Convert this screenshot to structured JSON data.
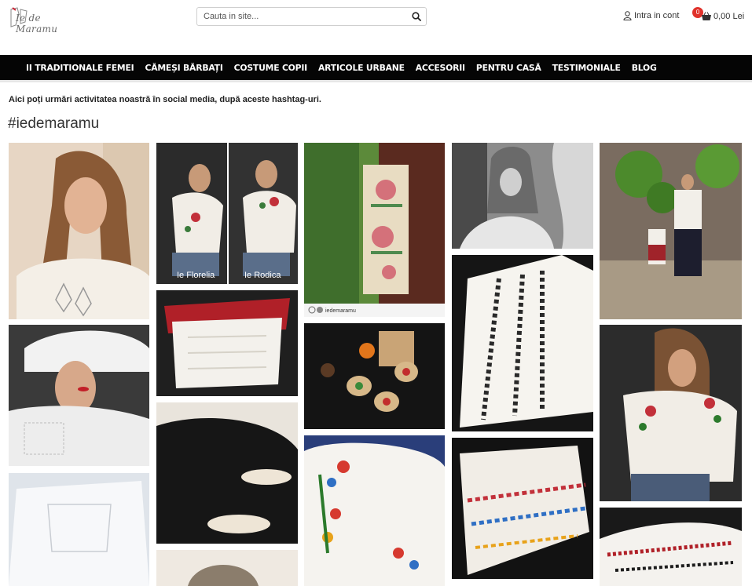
{
  "header": {
    "logo_text": "Ie de Maramu",
    "search_placeholder": "Cauta in site...",
    "account_label": "Intra in cont",
    "cart_count": "0",
    "cart_total": "0,00 Lei"
  },
  "nav": {
    "items": [
      "II TRADITIONALE FEMEI",
      "CĂMEȘI BĂRBAȚI",
      "COSTUME COPII",
      "ARTICOLE URBANE",
      "ACCESORII",
      "PENTRU CASĂ",
      "TESTIMONIALE",
      "BLOG"
    ]
  },
  "main": {
    "intro": "Aici poți urmări activitatea noastră în social media, după aceste hashtag-uri.",
    "hashtag": "#iedemaramu"
  },
  "gallery": {
    "captions": {
      "florelia": "Ie Florelia",
      "rodica": "Ie Rodica",
      "repost_handle": "iedemaramu"
    }
  },
  "colors": {
    "nav_bg": "#050505",
    "badge": "#e0322b"
  }
}
